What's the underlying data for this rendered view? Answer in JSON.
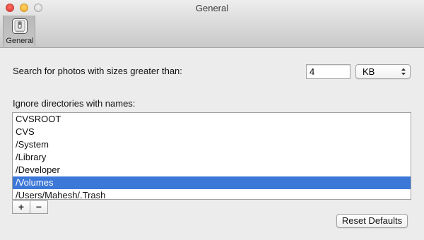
{
  "window": {
    "title": "General"
  },
  "toolbar": {
    "items": [
      {
        "label": "General",
        "icon": "general-preferences-icon",
        "selected": true
      }
    ]
  },
  "settings": {
    "size_label": "Search for photos with sizes greater than:",
    "size_value": "4",
    "size_unit": "KB",
    "ignore_label": "Ignore directories with names:"
  },
  "directories": {
    "items": [
      {
        "name": "CVSROOT",
        "selected": false
      },
      {
        "name": "CVS",
        "selected": false
      },
      {
        "name": "/System",
        "selected": false
      },
      {
        "name": "/Library",
        "selected": false
      },
      {
        "name": "/Developer",
        "selected": false
      },
      {
        "name": "/Volumes",
        "selected": true
      },
      {
        "name": "/Users/Mahesh/.Trash",
        "selected": false
      }
    ]
  },
  "controls": {
    "add_label": "+",
    "remove_label": "−",
    "reset_label": "Reset Defaults"
  },
  "colors": {
    "selection": "#3c78d8",
    "close": "#e2463f",
    "minimize": "#f2b53a",
    "zoom_disabled": "#d7d7d7"
  }
}
